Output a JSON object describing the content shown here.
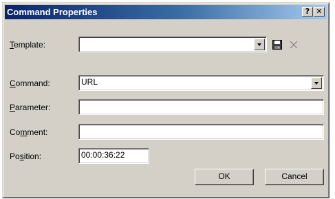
{
  "window": {
    "title": "Command Properties",
    "help_label": "?",
    "close_label": "✕"
  },
  "form": {
    "template": {
      "label_underlined": "T",
      "label_rest": "emplate:",
      "value": ""
    },
    "command": {
      "label_underlined": "C",
      "label_rest": "ommand:",
      "value": "URL"
    },
    "parameter": {
      "label_underlined": "P",
      "label_rest": "arameter:",
      "value": ""
    },
    "comment": {
      "label_pre": "Co",
      "label_underlined": "m",
      "label_rest": "ment:",
      "value": ""
    },
    "position": {
      "label_pre": "Po",
      "label_underlined": "s",
      "label_rest": "ition:",
      "value": "00:00:36:22"
    }
  },
  "buttons": {
    "ok": "OK",
    "cancel": "Cancel"
  },
  "icons": {
    "save": "save-icon",
    "delete": "delete-icon"
  }
}
